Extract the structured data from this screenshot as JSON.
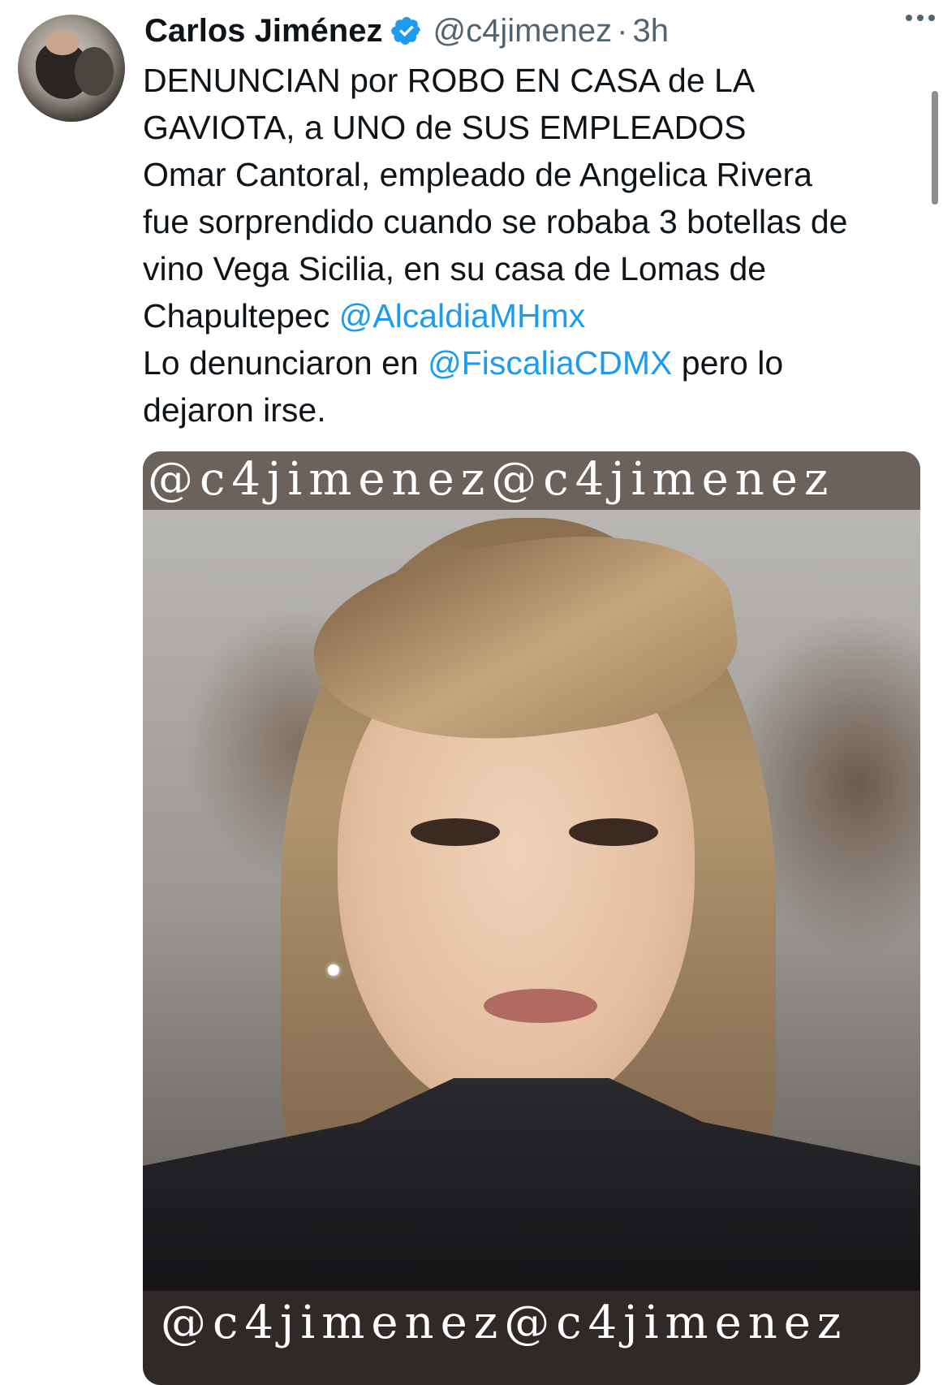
{
  "author": {
    "name": "Carlos Jiménez",
    "handle": "@c4jimenez",
    "separator": "·",
    "time": "3h",
    "verified": true,
    "verified_color": "#1d9bf0"
  },
  "menu": {
    "icon": "more-horizontal-icon"
  },
  "tweet": {
    "lines": [
      {
        "text": "DENUNCIAN por ROBO EN CASA de LA"
      },
      {
        "text": "GAVIOTA, a UNO de SUS EMPLEADOS"
      },
      {
        "text": "Omar Cantoral, empleado de Angelica Rivera"
      },
      {
        "text": "fue sorprendido cuando se robaba 3 botellas de"
      },
      {
        "text": "vino Vega Sicilia, en su casa de Lomas de"
      },
      {
        "text": "Chapultepec ",
        "mention": "@AlcaldiaMHmx"
      },
      {
        "text": "Lo denunciaron en ",
        "mention": "@FiscaliaCDMX",
        "after": " pero lo"
      },
      {
        "text": "dejaron irse."
      }
    ],
    "mention_color": "#1d9bf0"
  },
  "media": {
    "watermark_top": "@c4jimenez@c4jimenez",
    "watermark_bottom": "@c4jimenez@c4jimenez"
  }
}
